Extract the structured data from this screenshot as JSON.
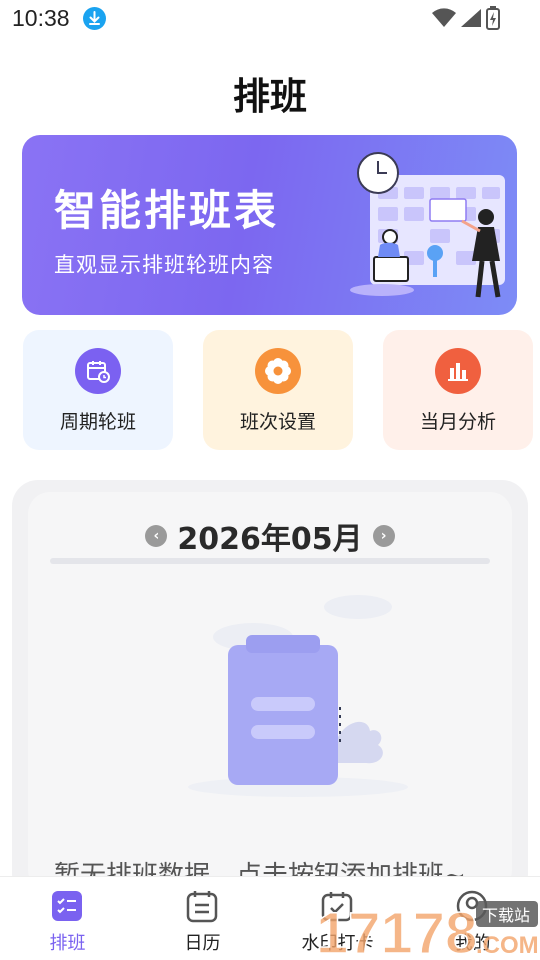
{
  "status_bar": {
    "time": "10:38",
    "download_icon": "download-icon",
    "wifi_icon": "wifi-icon",
    "signal_icon": "signal-icon",
    "battery_icon": "battery-charging-icon"
  },
  "page": {
    "title": "排班"
  },
  "banner": {
    "title": "智能排班表",
    "subtitle": "直观显示排班轮班内容"
  },
  "quick_actions": [
    {
      "label": "周期轮班",
      "icon": "calendar-clock-icon",
      "bg": "#eef5ff",
      "icon_bg": "#7b61f1"
    },
    {
      "label": "班次设置",
      "icon": "gear-icon",
      "bg": "#fff3de",
      "icon_bg": "#f7923b"
    },
    {
      "label": "当月分析",
      "icon": "bar-chart-icon",
      "bg": "#fff0ea",
      "icon_bg": "#f0603f"
    }
  ],
  "calendar": {
    "month": "2026年05月",
    "prev_icon": "chevron-left-icon",
    "next_icon": "chevron-right-icon",
    "empty_text": "暂无排班数据，点击按钮添加排班~",
    "empty_icon": "clipboard-illustration"
  },
  "bottom_nav": [
    {
      "label": "排班",
      "icon": "schedule-list-icon",
      "active": true
    },
    {
      "label": "日历",
      "icon": "calendar-icon",
      "active": false
    },
    {
      "label": "水印打卡",
      "icon": "camera-check-icon",
      "active": false
    },
    {
      "label": "我的",
      "icon": "profile-icon",
      "active": false
    }
  ],
  "watermark": {
    "text": "17178",
    "suffix": ".COM",
    "badge": "下载站"
  },
  "colors": {
    "accent": "#7a62f0",
    "banner": "#8a73f4"
  }
}
